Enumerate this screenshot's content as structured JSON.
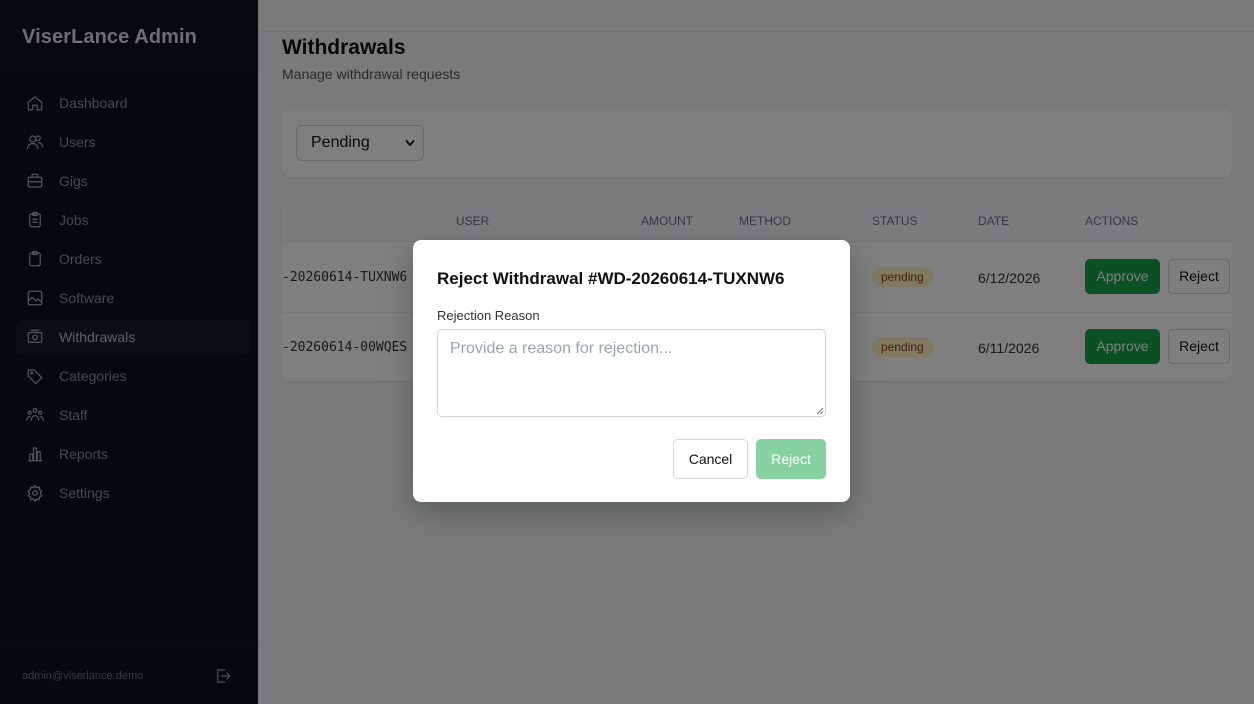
{
  "app": {
    "title": "ViserLance Admin"
  },
  "sidebar": {
    "items": [
      {
        "label": "Dashboard",
        "icon": "home-icon"
      },
      {
        "label": "Users",
        "icon": "users-icon"
      },
      {
        "label": "Gigs",
        "icon": "briefcase-icon"
      },
      {
        "label": "Jobs",
        "icon": "clipboard-list-icon"
      },
      {
        "label": "Orders",
        "icon": "clipboard-icon"
      },
      {
        "label": "Software",
        "icon": "image-icon"
      },
      {
        "label": "Withdrawals",
        "icon": "banknote-icon",
        "active": true
      },
      {
        "label": "Categories",
        "icon": "tag-icon"
      },
      {
        "label": "Staff",
        "icon": "team-icon"
      },
      {
        "label": "Reports",
        "icon": "bar-chart-icon"
      },
      {
        "label": "Settings",
        "icon": "gear-icon"
      }
    ],
    "footer": {
      "email": "admin@viserlance.demo",
      "logout_icon": "logout-icon"
    }
  },
  "page": {
    "title": "Withdrawals",
    "subtitle": "Manage withdrawal requests",
    "filter": {
      "selected": "Pending"
    }
  },
  "table": {
    "columns": [
      "USER",
      "AMOUNT",
      "METHOD",
      "STATUS",
      "DATE",
      "ACTIONS"
    ],
    "rows": [
      {
        "ref": "-20260614-TUXNW6",
        "status": "pending",
        "date": "6/12/2026",
        "approve": "Approve",
        "reject": "Reject"
      },
      {
        "ref": "-20260614-00WQES",
        "status": "pending",
        "date": "6/11/2026",
        "approve": "Approve",
        "reject": "Reject"
      }
    ]
  },
  "modal": {
    "title": "Reject Withdrawal #WD-20260614-TUXNW6",
    "label": "Rejection Reason",
    "placeholder": "Provide a reason for rejection...",
    "value": "",
    "cancel": "Cancel",
    "reject": "Reject"
  },
  "colors": {
    "sidebar_bg": "#0b1119",
    "approve": "#16a34a",
    "reject_disabled": "#86d1a0",
    "badge_bg": "#fef3c7",
    "badge_text": "#92400e"
  }
}
